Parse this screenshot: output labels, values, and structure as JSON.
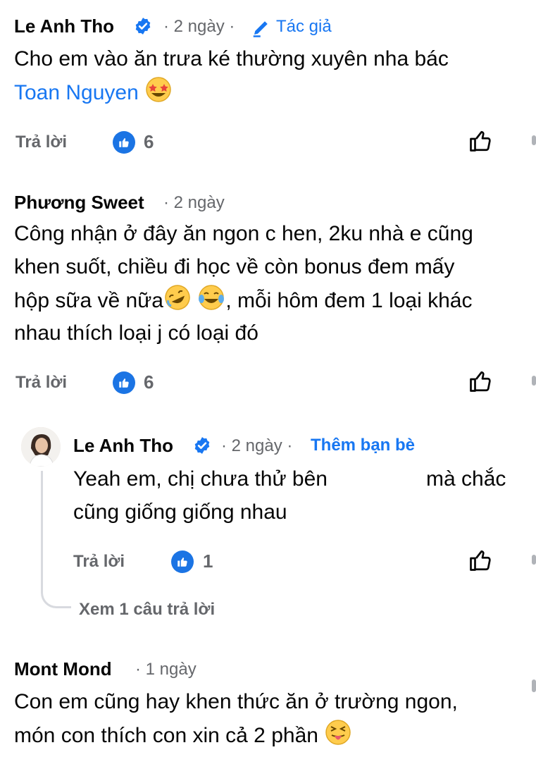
{
  "comments": [
    {
      "author": "Le Anh Tho",
      "time": "· 2 ngày ·",
      "badge": "Tác giả",
      "text_line1": "Cho em vào ăn trưa ké thường xuyên nha bác",
      "mention": "Toan Nguyen",
      "reply_label": "Trả lời",
      "like_count": "6"
    },
    {
      "author": "Phương Sweet",
      "time": "· 2 ngày",
      "lines": [
        "Công nhận ở đây ăn ngon c hen, 2ku nhà e cũng",
        "khen suốt, chiều đi học về còn bonus đem mấy",
        "hộp sữa về nữa",
        ", mỗi hôm đem 1 loại khác",
        "nhau thích loại j có loại đó"
      ],
      "reply_label": "Trả lời",
      "like_count": "6"
    },
    {
      "author": "Mont Mond",
      "time": "· 1 ngày",
      "lines": [
        "Con em cũng hay khen thức ăn ở trường ngon,",
        "món con thích con xin cả 2 phần"
      ]
    }
  ],
  "reply": {
    "author": "Le Anh Tho",
    "time": "· 2 ngày ·",
    "add_friend": "Thêm bạn bè",
    "line1_part1": "Yeah em, chị chưa thử bên",
    "line1_part2": "mà chắc",
    "line2": "cũng giống giống nhau",
    "reply_label": "Trả lời",
    "like_count": "1",
    "view_more": "Xem 1 câu trả lời"
  },
  "colors": {
    "link": "#1877f2",
    "like_badge": "#1b74e4",
    "secondary_text": "#65676b"
  },
  "icons": [
    "verified-icon",
    "pencil-icon",
    "like-badge-icon",
    "thumbs-up-icon",
    "emoji-star-struck",
    "emoji-rofl",
    "emoji-tears-of-joy",
    "emoji-tongue"
  ]
}
